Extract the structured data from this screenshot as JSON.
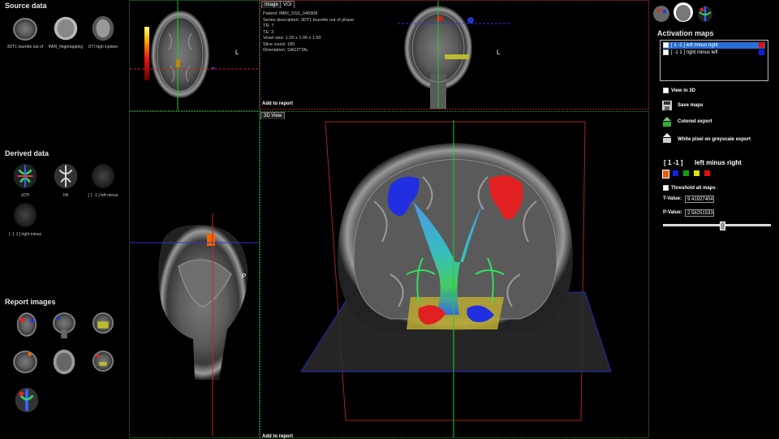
{
  "left": {
    "source_title": "Source data",
    "source_items": [
      "3DT1 tourette out of",
      "fMRI_fingertapping",
      "DTI high inplane"
    ],
    "derived_title": "Derived data",
    "derived_items": [
      "cDTI",
      "FA",
      "[ 1 -1 ]   left minus",
      "[ -1  1 ]   right minus"
    ],
    "report_title": "Report images"
  },
  "info": {
    "tabs": [
      "Image",
      "VOI"
    ],
    "lines": [
      "Patient: fMRI_SSS_040908",
      "Series description: 3DT1 tourette out of phase",
      "TR: 7",
      "TE: 3",
      "Voxel size: 1.00 x 1.00 x 1.00",
      "Slice count: 180",
      "Orientation: SAGITTAL"
    ],
    "add_to_report": "Add to report"
  },
  "view3d": {
    "tab": "3D View",
    "add_to_report": "Add to report"
  },
  "orient": {
    "axial_L": "L",
    "coronal_L": "L",
    "sagittal_P": "P"
  },
  "right": {
    "activation_title": "Activation maps",
    "maps": [
      {
        "label": "[  1  -1  ]        left minus right",
        "color": "#e01010",
        "selected": true
      },
      {
        "label": "[  -1  1  ]        right minus left",
        "color": "#1020e0",
        "selected": false
      }
    ],
    "view_in_3d": "View in 3D",
    "save_maps": "Save maps",
    "colored_export": "Colored export",
    "white_pixel_export": "White pixel on greyscale export",
    "current_contrast": "[  1  -1  ]",
    "current_name": "left minus right",
    "swatches": [
      "#e06010",
      "#1020e0",
      "#10a010",
      "#e0e010",
      "#e01010"
    ],
    "threshold_all": "Threshold all maps",
    "t_label": "T-Value:",
    "t_value": "9.41927404",
    "p_label": "P-Value:",
    "p_value": "2.56251533",
    "slider_fraction": 0.55
  }
}
